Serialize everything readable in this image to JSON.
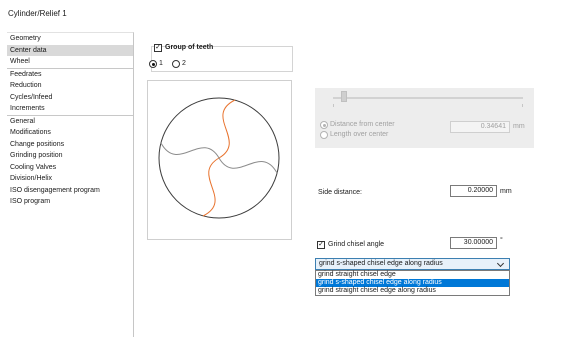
{
  "window": {
    "title": "Cylinder/Relief 1"
  },
  "sidebar": {
    "items": [
      {
        "label": "Geometry"
      },
      {
        "label": "Center data"
      },
      {
        "label": "Wheel"
      },
      {
        "label": "Feedrates"
      },
      {
        "label": "Reduction"
      },
      {
        "label": "Cycles/Infeed"
      },
      {
        "label": "Increments"
      },
      {
        "label": "General"
      },
      {
        "label": "Modifications"
      },
      {
        "label": "Change positions"
      },
      {
        "label": "Grinding position"
      },
      {
        "label": "Cooling Valves"
      },
      {
        "label": "Division/Helix"
      },
      {
        "label": "ISO disengagement program"
      },
      {
        "label": "ISO program"
      }
    ],
    "selected": "Center data"
  },
  "group": {
    "label": "Group of teeth",
    "checked": true,
    "options": [
      "1",
      "2"
    ],
    "selected": "1"
  },
  "center": {
    "mode_options": [
      "Distance from center",
      "Length over center"
    ],
    "value": "0.34641",
    "unit": "mm"
  },
  "side": {
    "label": "Side distance:",
    "value": "0.20000",
    "unit": "mm"
  },
  "chisel": {
    "label": "Grind chisel angle",
    "checked": true,
    "value": "30.00000",
    "unit": "°",
    "selected": "grind s-shaped chisel edge along radius",
    "options": [
      "grind straight chisel edge",
      "grind s-shaped chisel edge along radius",
      "grind straight chisel edge along radius"
    ],
    "highlighted_option": "grind s-shaped chisel edge along radius"
  },
  "colors": {
    "accent": "#0078d7",
    "curve_highlight": "#e8732e",
    "curve_default": "#8c8c8c",
    "selection_bg": "#d9d9d9"
  }
}
